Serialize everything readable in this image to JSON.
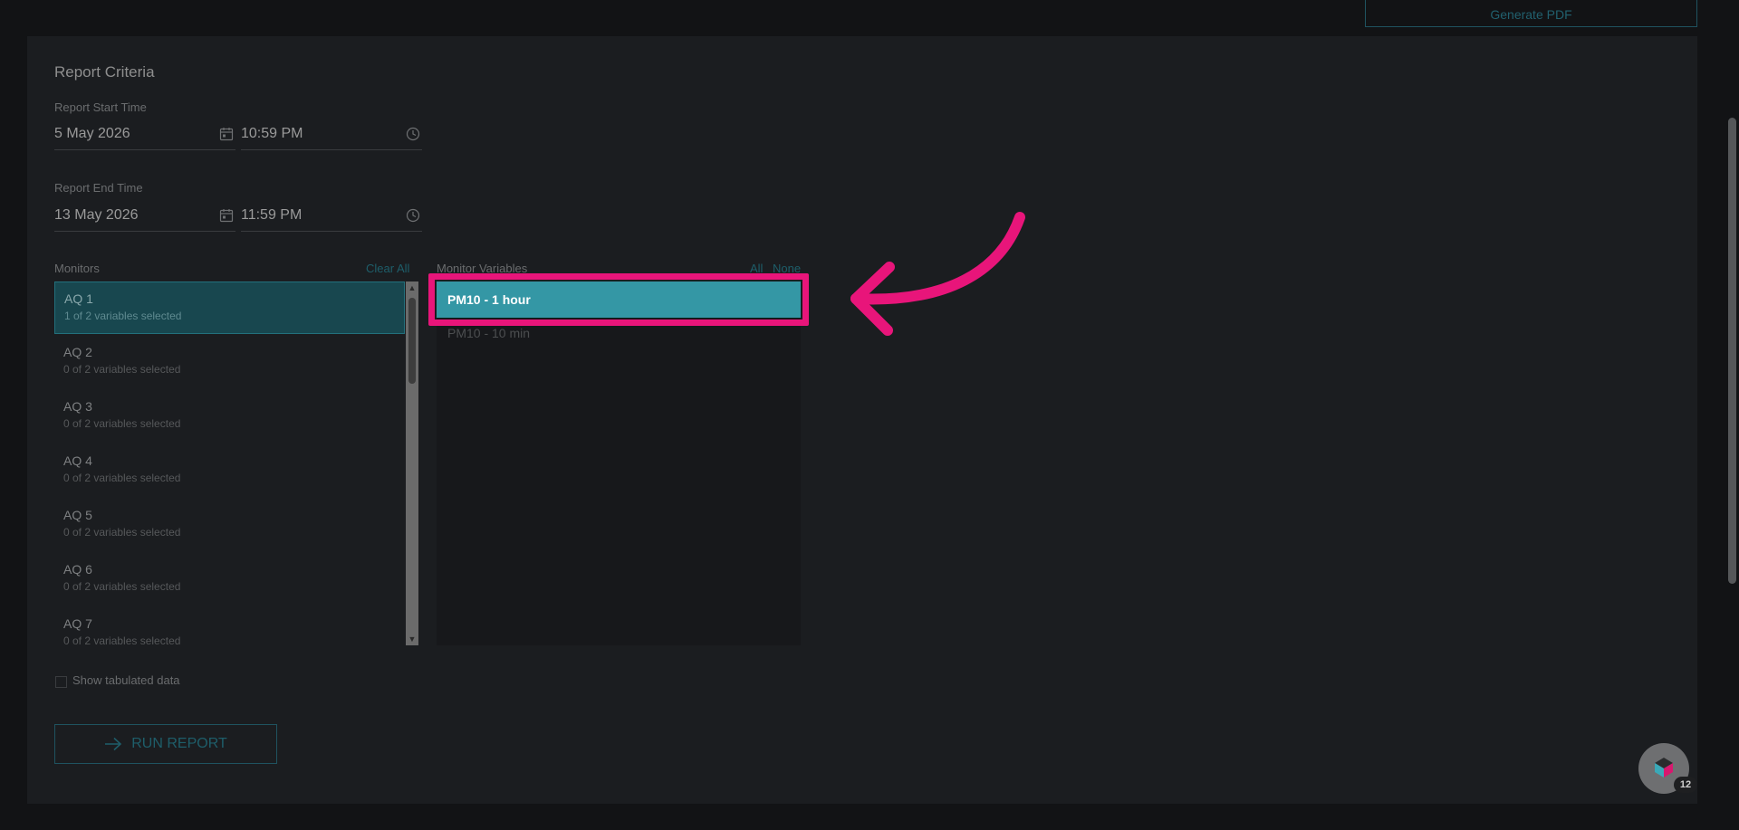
{
  "toolbar": {
    "generate_pdf_label": "Generate PDF"
  },
  "report_criteria": {
    "title": "Report Criteria",
    "start": {
      "label": "Report Start Time",
      "date": "5 May 2026",
      "time": "10:59 PM"
    },
    "end": {
      "label": "Report End Time",
      "date": "13 May 2026",
      "time": "11:59 PM"
    }
  },
  "monitors": {
    "label": "Monitors",
    "clear_all_label": "Clear All",
    "items": [
      {
        "name": "AQ 1",
        "sub": "1 of 2 variables selected",
        "selected": true
      },
      {
        "name": "AQ 2",
        "sub": "0 of 2 variables selected",
        "selected": false
      },
      {
        "name": "AQ 3",
        "sub": "0 of 2 variables selected",
        "selected": false
      },
      {
        "name": "AQ 4",
        "sub": "0 of 2 variables selected",
        "selected": false
      },
      {
        "name": "AQ 5",
        "sub": "0 of 2 variables selected",
        "selected": false
      },
      {
        "name": "AQ 6",
        "sub": "0 of 2 variables selected",
        "selected": false
      },
      {
        "name": "AQ 7",
        "sub": "0 of 2 variables selected",
        "selected": false
      }
    ]
  },
  "monitor_variables": {
    "label": "Monitor Variables",
    "all_label": "All",
    "none_label": "None",
    "items": [
      {
        "name": "PM10 - 1 hour",
        "selected": true
      },
      {
        "name": "PM10 - 10 min",
        "selected": false
      }
    ]
  },
  "options": {
    "show_tabulated_label": "Show tabulated data"
  },
  "actions": {
    "run_report_label": "RUN REPORT"
  },
  "helper": {
    "badge_count": "12"
  },
  "colors": {
    "accent": "#3497a5",
    "highlight": "#e8157a",
    "background": "#121315",
    "panel": "#1b1d20"
  }
}
